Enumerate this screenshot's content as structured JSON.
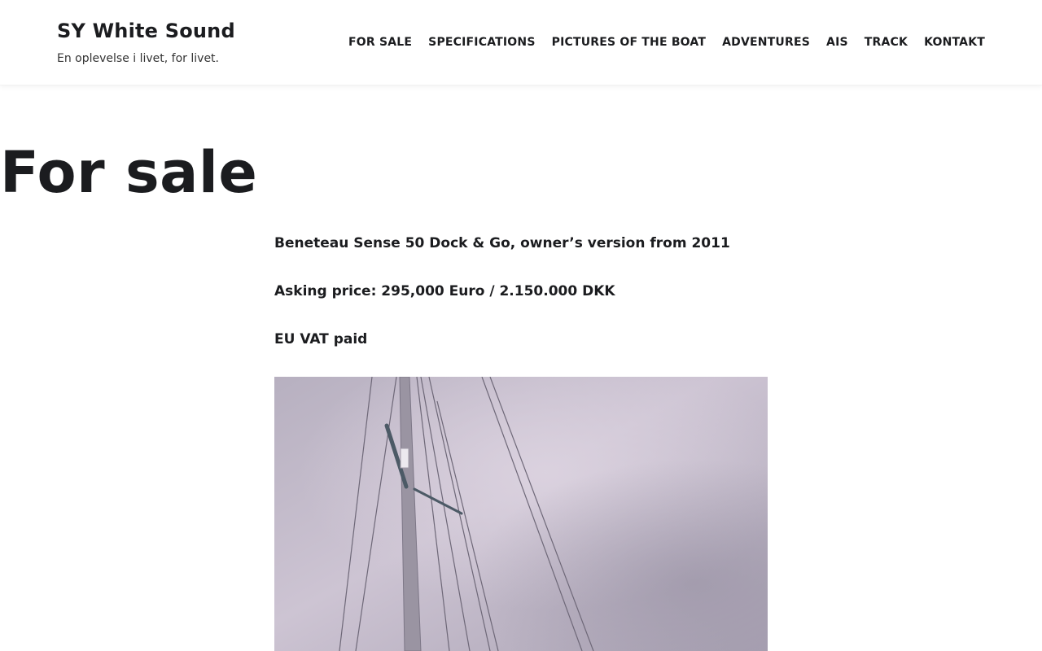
{
  "site": {
    "title": "SY White Sound",
    "tagline": "En oplevelse i livet, for livet."
  },
  "nav": {
    "items": [
      {
        "label": "FOR SALE"
      },
      {
        "label": "SPECIFICATIONS"
      },
      {
        "label": "PICTURES OF THE BOAT"
      },
      {
        "label": "ADVENTURES"
      },
      {
        "label": "AIS"
      },
      {
        "label": "TRACK"
      },
      {
        "label": "KONTAKT"
      }
    ]
  },
  "page": {
    "title": "For sale",
    "lines": [
      "Beneteau Sense 50 Dock & Go, owner’s version from 2011",
      "Asking price: 295,000 Euro / 2.150.000 DKK",
      "EU VAT paid"
    ]
  },
  "colors": {
    "text": "#1b1c1f",
    "sky": "#bdb7c6",
    "mast": "#8f8a98",
    "rigging": "#6f6a78"
  }
}
